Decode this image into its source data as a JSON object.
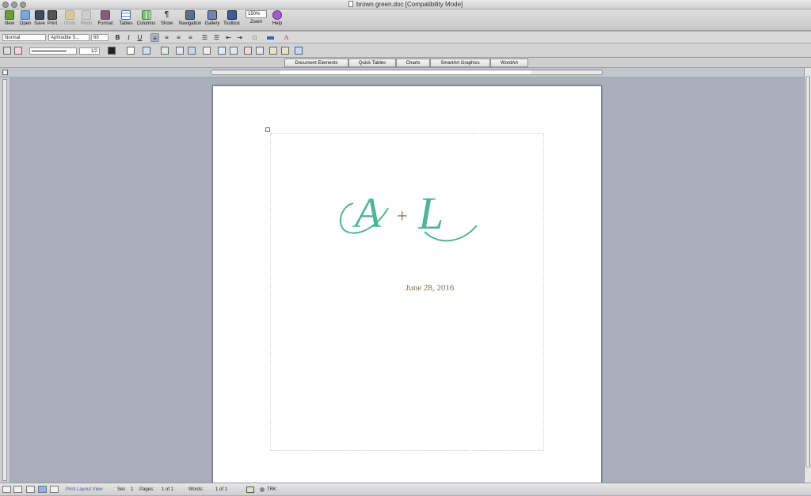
{
  "window": {
    "title": "brown green.doc [Compatibility Mode]"
  },
  "toolbar": {
    "buttons": [
      {
        "label": "New",
        "icon": "new-document-icon"
      },
      {
        "label": "Open",
        "icon": "open-folder-icon"
      },
      {
        "label": "Save",
        "icon": "save-disk-icon"
      },
      {
        "label": "Print",
        "icon": "printer-icon"
      },
      {
        "label": "Undo",
        "icon": "undo-icon"
      },
      {
        "label": "Redo",
        "icon": "redo-icon"
      },
      {
        "label": "Format",
        "icon": "format-brush-icon"
      },
      {
        "label": "Tables",
        "icon": "table-grid-icon"
      },
      {
        "label": "Columns",
        "icon": "columns-icon"
      },
      {
        "label": "Show",
        "icon": "pilcrow-icon"
      },
      {
        "label": "Navigation",
        "icon": "navigation-pane-icon"
      },
      {
        "label": "Gallery",
        "icon": "gallery-icon"
      },
      {
        "label": "Toolbox",
        "icon": "toolbox-icon"
      },
      {
        "label": "Zoom",
        "icon": "zoom-icon"
      },
      {
        "label": "Help",
        "icon": "help-icon"
      }
    ],
    "zoom_value": "150%"
  },
  "format": {
    "style": "Normal",
    "font": "Aphrodite S...",
    "size": "60",
    "bold": "B",
    "italic": "I",
    "underline": "U",
    "font_color": "A"
  },
  "tablebar": {
    "line_weight": "1/2"
  },
  "ribbon": {
    "tabs": [
      "Document Elements",
      "Quick Tables",
      "Charts",
      "SmartArt Graphics",
      "WordArt"
    ]
  },
  "document": {
    "monogram_left": "A",
    "monogram_plus": "+",
    "monogram_right": "L",
    "date": "June 28, 2016"
  },
  "colors": {
    "monogram": "#4fb596",
    "plus": "#7d6f4d",
    "date": "#7d6f4d"
  },
  "status": {
    "view": "Print Layout View",
    "sec_label": "Sec",
    "sec_value": "1",
    "pages_label": "Pages:",
    "pages_value": "1 of 1",
    "words_label": "Words:",
    "words_value": "1 of 1",
    "trk": "TRK"
  }
}
